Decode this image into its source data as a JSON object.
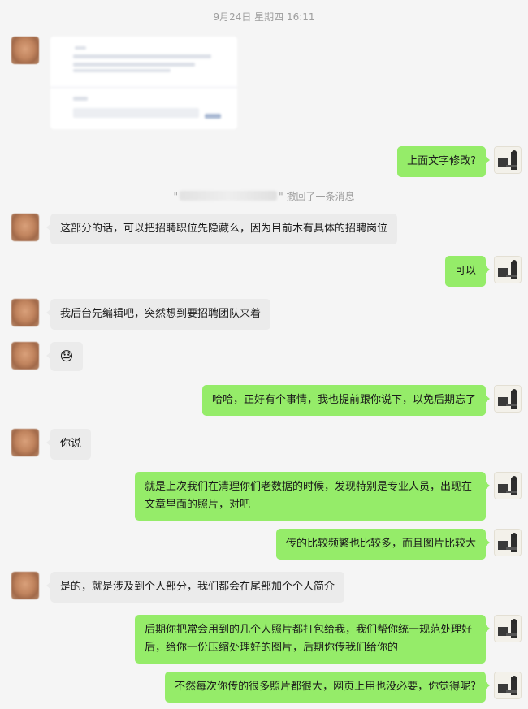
{
  "timestamp": "9月24日 星期四 16:11",
  "recall_notice": {
    "quote_open": "\"",
    "quote_close": "\"",
    "text": "撤回了一条消息"
  },
  "messages": [
    {
      "from": "other",
      "kind": "image"
    },
    {
      "from": "self",
      "text": "上面文字修改?"
    },
    {
      "from": "other",
      "text": "这部分的话，可以把招聘职位先隐藏么，因为目前木有具体的招聘岗位"
    },
    {
      "from": "self",
      "text": "可以"
    },
    {
      "from": "other",
      "text": "我后台先编辑吧，突然想到要招聘团队来着"
    },
    {
      "from": "other",
      "kind": "emoji",
      "icon": "😓"
    },
    {
      "from": "self",
      "text": "哈哈，正好有个事情，我也提前跟你说下，以免后期忘了"
    },
    {
      "from": "other",
      "text": "你说"
    },
    {
      "from": "self",
      "lines": [
        "就是上次我们在清理你们老数据的时候，发现特别是专业人员，出现在",
        "文章里面的照片，对吧"
      ]
    },
    {
      "from": "self",
      "text": "传的比较频繁也比较多，而且图片比较大"
    },
    {
      "from": "other",
      "text": "是的，就是涉及到个人部分，我们都会在尾部加个个人简介"
    },
    {
      "from": "self",
      "lines": [
        "后期你把常会用到的几个人照片都打包给我，我们帮你统一规范处理好",
        "后，给你一份压缩处理好的图片，后期你传我们给你的"
      ]
    },
    {
      "from": "self",
      "text": "不然每次你传的很多照片都很大，网页上用也没必要，你觉得呢?"
    }
  ],
  "colors": {
    "background": "#f5f5f5",
    "self_bubble": "#95ec69",
    "other_bubble": "#ebebeb",
    "meta_text": "#9e9e9e"
  }
}
